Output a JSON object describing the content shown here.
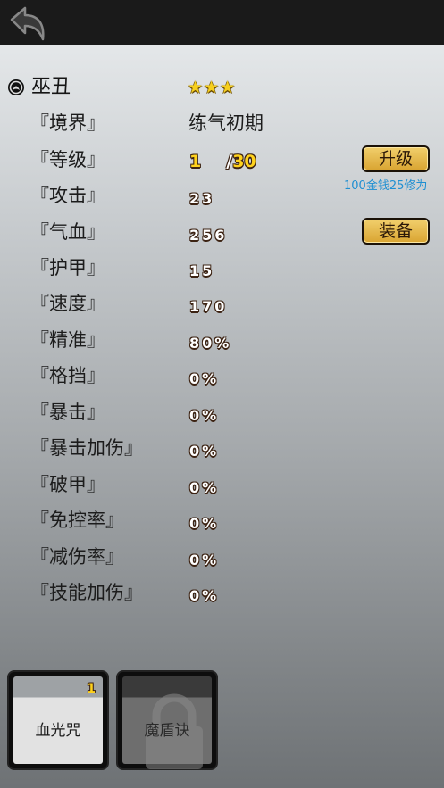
{
  "hero": {
    "name": "巫丑",
    "stars": "★★★"
  },
  "stats": [
    {
      "label": "『境界』",
      "value": "练气初期"
    },
    {
      "label": "『等级』",
      "value": "1"
    },
    {
      "label": "『攻击』",
      "value": "23"
    },
    {
      "label": "『气血』",
      "value": "256"
    },
    {
      "label": "『护甲』",
      "value": "15"
    },
    {
      "label": "『速度』",
      "value": "170"
    },
    {
      "label": "『精准』",
      "value": "80%"
    },
    {
      "label": "『格挡』",
      "value": "0%"
    },
    {
      "label": "『暴击』",
      "value": "0%"
    },
    {
      "label": "『暴击加伤』",
      "value": "0%"
    },
    {
      "label": "『破甲』",
      "value": "0%"
    },
    {
      "label": "『免控率』",
      "value": "0%"
    },
    {
      "label": "『减伤率』",
      "value": "0%"
    },
    {
      "label": "『技能加伤』",
      "value": "0%"
    }
  ],
  "level": {
    "current": "1",
    "separator": "/",
    "max": "30"
  },
  "buttons": {
    "upgrade": "升级",
    "upgrade_cost": "100金钱25修为",
    "equip": "装备"
  },
  "skills": [
    {
      "name": "血光咒",
      "count": "1",
      "locked": false
    },
    {
      "name": "魔盾诀",
      "locked": true
    }
  ],
  "icons": {
    "back": "back-arrow-icon",
    "hero": "hero-emblem-icon",
    "lock": "lock-icon"
  },
  "colors": {
    "gold": "#ffd21c",
    "cost_text": "#1f8fd2",
    "button_fill": "#e6b84a"
  }
}
